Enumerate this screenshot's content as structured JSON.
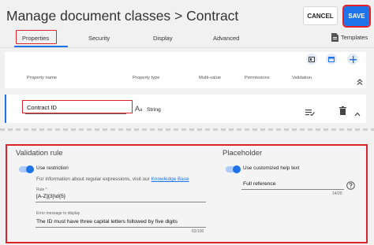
{
  "header": {
    "title": "Manage document classes",
    "breadcrumb_sep": ">",
    "breadcrumb_current": "Contract",
    "cancel_label": "CANCEL",
    "save_label": "SAVE"
  },
  "tabs": [
    {
      "label": "Properties",
      "active": true
    },
    {
      "label": "Security"
    },
    {
      "label": "Display"
    },
    {
      "label": "Advanced"
    }
  ],
  "templates_label": "Templates",
  "table": {
    "columns": [
      "Property name",
      "Property type",
      "Multi-value",
      "Permissions",
      "Validation"
    ],
    "row": {
      "name": "Contract ID",
      "type_icon": "Aa",
      "type": "String"
    }
  },
  "validation": {
    "title": "Validation rule",
    "toggle_label": "Use restriction",
    "toggle_on": true,
    "info_text": "For information about regular expressions, visit our",
    "info_link": "Knowledge Base",
    "rule_label": "Rule *",
    "rule_value": "[A-Z]{3}\\d{5}",
    "error_label": "Error message to display",
    "error_value": "The ID must have three capital letters followed by five digits",
    "error_counter": "62/100"
  },
  "placeholder": {
    "title": "Placeholder",
    "toggle_label": "Use customized help text",
    "toggle_on": true,
    "value": "Full reference",
    "counter": "14/20"
  },
  "colors": {
    "accent": "#1f73e8",
    "highlight": "#d9262d"
  }
}
